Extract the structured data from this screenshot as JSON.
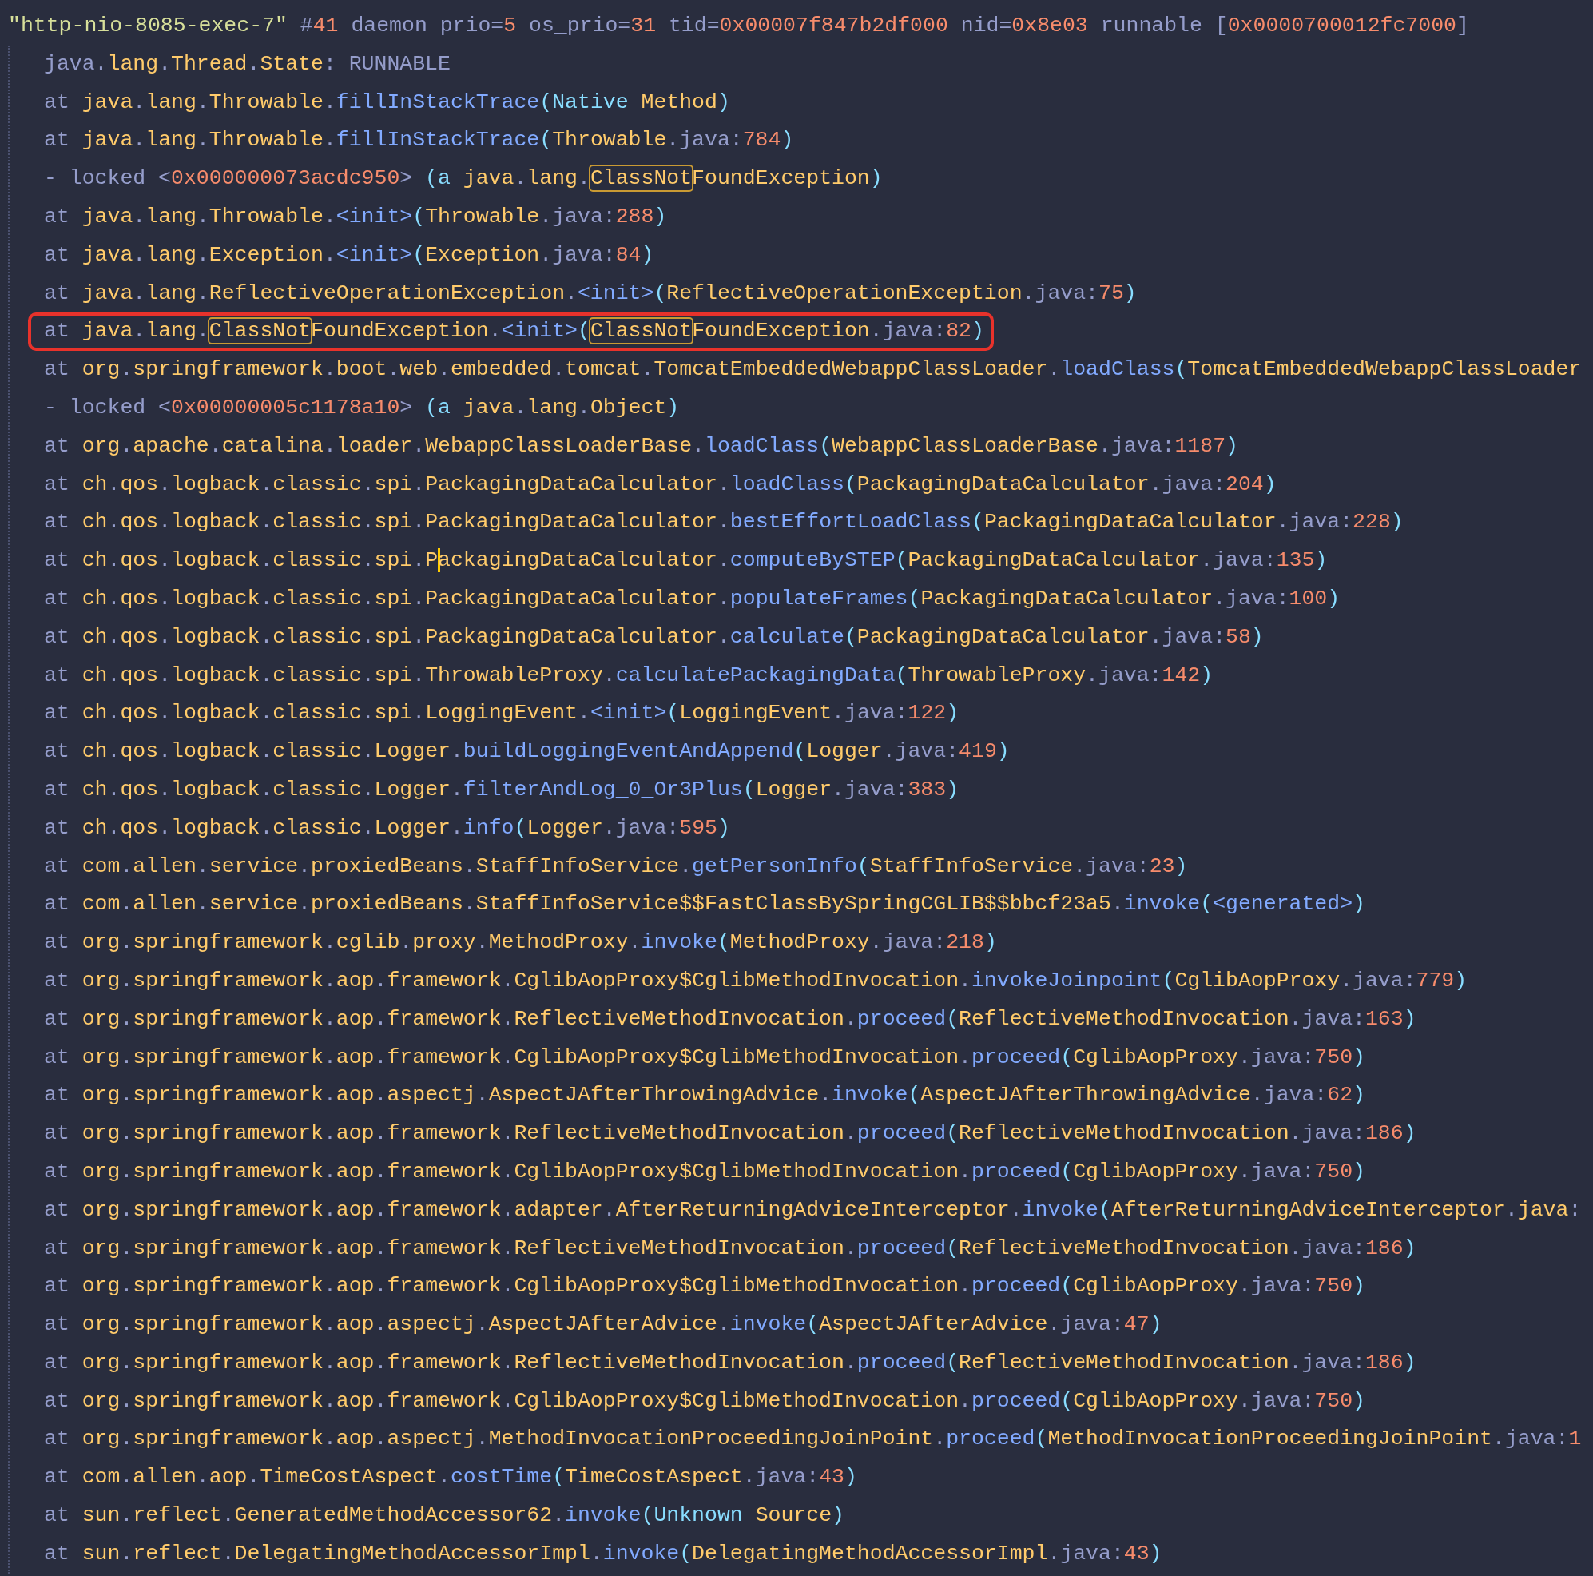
{
  "lines": [
    {
      "kind": "header",
      "boxed": false,
      "text": "\"http-nio-8085-exec-7\" #41 daemon prio=5 os_prio=31 tid=0x00007f847b2df000 nid=0x8e03 runnable [0x0000700012fc7000]"
    },
    {
      "kind": "frame",
      "boxed": false,
      "text": "java.lang.Thread.State: RUNNABLE"
    },
    {
      "kind": "frame",
      "boxed": false,
      "text": "at java.lang.Throwable.fillInStackTrace(Native Method)"
    },
    {
      "kind": "frame",
      "boxed": false,
      "text": "at java.lang.Throwable.fillInStackTrace(Throwable.java:784)"
    },
    {
      "kind": "frame",
      "boxed": false,
      "parts": [
        {
          "text": "- locked <0x000000073acdc950> (a java.lang.",
          "match": false
        },
        {
          "text": "ClassNot",
          "match": true
        },
        {
          "text": "FoundException)",
          "match": false
        }
      ]
    },
    {
      "kind": "frame",
      "boxed": false,
      "text": "at java.lang.Throwable.<init>(Throwable.java:288)"
    },
    {
      "kind": "frame",
      "boxed": false,
      "text": "at java.lang.Exception.<init>(Exception.java:84)"
    },
    {
      "kind": "frame",
      "boxed": false,
      "text": "at java.lang.ReflectiveOperationException.<init>(ReflectiveOperationException.java:75)"
    },
    {
      "kind": "frame",
      "boxed": true,
      "parts": [
        {
          "text": "at java.lang.",
          "match": false
        },
        {
          "text": "ClassNot",
          "match": true
        },
        {
          "text": "FoundException.<init>(",
          "match": false
        },
        {
          "text": "ClassNot",
          "match": true
        },
        {
          "text": "FoundException.java:82)",
          "match": false
        }
      ]
    },
    {
      "kind": "frame",
      "boxed": false,
      "text": "at org.springframework.boot.web.embedded.tomcat.TomcatEmbeddedWebappClassLoader.loadClass(TomcatEmbeddedWebappClassLoader"
    },
    {
      "kind": "frame",
      "boxed": false,
      "text": "- locked <0x00000005c1178a10> (a java.lang.Object)"
    },
    {
      "kind": "frame",
      "boxed": false,
      "text": "at org.apache.catalina.loader.WebappClassLoaderBase.loadClass(WebappClassLoaderBase.java:1187)"
    },
    {
      "kind": "frame",
      "boxed": false,
      "text": "at ch.qos.logback.classic.spi.PackagingDataCalculator.loadClass(PackagingDataCalculator.java:204)"
    },
    {
      "kind": "frame",
      "boxed": false,
      "text": "at ch.qos.logback.classic.spi.PackagingDataCalculator.bestEffortLoadClass(PackagingDataCalculator.java:228)"
    },
    {
      "kind": "frame",
      "boxed": false,
      "parts": [
        {
          "text": "at ch.qos.logback.classic.spi.P",
          "cursor": false
        },
        {
          "text": "ackagingDataCalculator.computeBySTEP(PackagingDataCalculator.java:135)",
          "cursor": true
        }
      ]
    },
    {
      "kind": "frame",
      "boxed": false,
      "text": "at ch.qos.logback.classic.spi.PackagingDataCalculator.populateFrames(PackagingDataCalculator.java:100)"
    },
    {
      "kind": "frame",
      "boxed": false,
      "text": "at ch.qos.logback.classic.spi.PackagingDataCalculator.calculate(PackagingDataCalculator.java:58)"
    },
    {
      "kind": "frame",
      "boxed": false,
      "text": "at ch.qos.logback.classic.spi.ThrowableProxy.calculatePackagingData(ThrowableProxy.java:142)"
    },
    {
      "kind": "frame",
      "boxed": false,
      "text": "at ch.qos.logback.classic.spi.LoggingEvent.<init>(LoggingEvent.java:122)"
    },
    {
      "kind": "frame",
      "boxed": false,
      "text": "at ch.qos.logback.classic.Logger.buildLoggingEventAndAppend(Logger.java:419)"
    },
    {
      "kind": "frame",
      "boxed": false,
      "text": "at ch.qos.logback.classic.Logger.filterAndLog_0_Or3Plus(Logger.java:383)"
    },
    {
      "kind": "frame",
      "boxed": false,
      "text": "at ch.qos.logback.classic.Logger.info(Logger.java:595)"
    },
    {
      "kind": "frame",
      "boxed": false,
      "text": "at com.allen.service.proxiedBeans.StaffInfoService.getPersonInfo(StaffInfoService.java:23)"
    },
    {
      "kind": "frame",
      "boxed": false,
      "text": "at com.allen.service.proxiedBeans.StaffInfoService$$FastClassBySpringCGLIB$$bbcf23a5.invoke(<generated>)"
    },
    {
      "kind": "frame",
      "boxed": false,
      "text": "at org.springframework.cglib.proxy.MethodProxy.invoke(MethodProxy.java:218)"
    },
    {
      "kind": "frame",
      "boxed": false,
      "text": "at org.springframework.aop.framework.CglibAopProxy$CglibMethodInvocation.invokeJoinpoint(CglibAopProxy.java:779)"
    },
    {
      "kind": "frame",
      "boxed": false,
      "text": "at org.springframework.aop.framework.ReflectiveMethodInvocation.proceed(ReflectiveMethodInvocation.java:163)"
    },
    {
      "kind": "frame",
      "boxed": false,
      "text": "at org.springframework.aop.framework.CglibAopProxy$CglibMethodInvocation.proceed(CglibAopProxy.java:750)"
    },
    {
      "kind": "frame",
      "boxed": false,
      "text": "at org.springframework.aop.aspectj.AspectJAfterThrowingAdvice.invoke(AspectJAfterThrowingAdvice.java:62)"
    },
    {
      "kind": "frame",
      "boxed": false,
      "text": "at org.springframework.aop.framework.ReflectiveMethodInvocation.proceed(ReflectiveMethodInvocation.java:186)"
    },
    {
      "kind": "frame",
      "boxed": false,
      "text": "at org.springframework.aop.framework.CglibAopProxy$CglibMethodInvocation.proceed(CglibAopProxy.java:750)"
    },
    {
      "kind": "frame",
      "boxed": false,
      "text": "at org.springframework.aop.framework.adapter.AfterReturningAdviceInterceptor.invoke(AfterReturningAdviceInterceptor.java:"
    },
    {
      "kind": "frame",
      "boxed": false,
      "text": "at org.springframework.aop.framework.ReflectiveMethodInvocation.proceed(ReflectiveMethodInvocation.java:186)"
    },
    {
      "kind": "frame",
      "boxed": false,
      "text": "at org.springframework.aop.framework.CglibAopProxy$CglibMethodInvocation.proceed(CglibAopProxy.java:750)"
    },
    {
      "kind": "frame",
      "boxed": false,
      "text": "at org.springframework.aop.aspectj.AspectJAfterAdvice.invoke(AspectJAfterAdvice.java:47)"
    },
    {
      "kind": "frame",
      "boxed": false,
      "text": "at org.springframework.aop.framework.ReflectiveMethodInvocation.proceed(ReflectiveMethodInvocation.java:186)"
    },
    {
      "kind": "frame",
      "boxed": false,
      "text": "at org.springframework.aop.framework.CglibAopProxy$CglibMethodInvocation.proceed(CglibAopProxy.java:750)"
    },
    {
      "kind": "frame",
      "boxed": false,
      "text": "at org.springframework.aop.aspectj.MethodInvocationProceedingJoinPoint.proceed(MethodInvocationProceedingJoinPoint.java:1"
    },
    {
      "kind": "frame",
      "boxed": false,
      "text": "at com.allen.aop.TimeCostAspect.costTime(TimeCostAspect.java:43)"
    },
    {
      "kind": "frame",
      "boxed": false,
      "text": "at sun.reflect.GeneratedMethodAccessor62.invoke(Unknown Source)"
    },
    {
      "kind": "frame",
      "boxed": false,
      "text": "at sun.reflect.DelegatingMethodAccessorImpl.invoke(DelegatingMethodAccessorImpl.java:43)"
    }
  ]
}
